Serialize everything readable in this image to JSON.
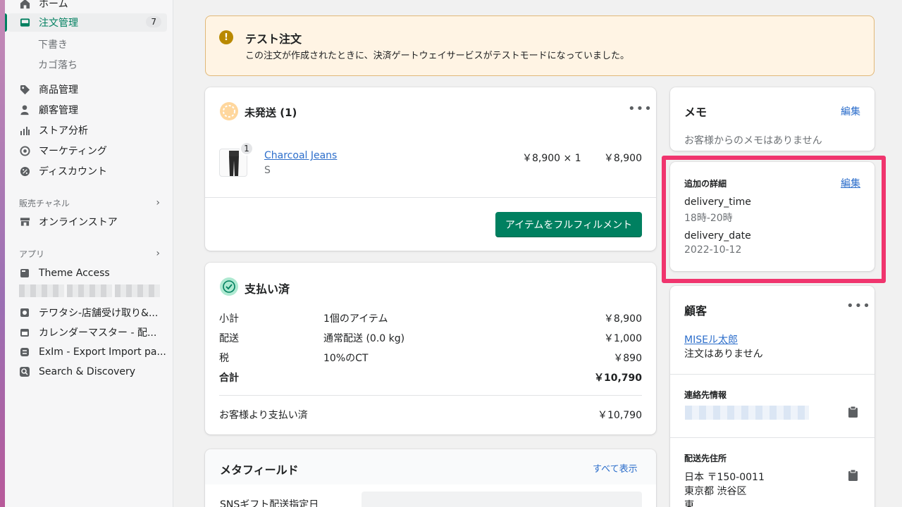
{
  "sidebar": {
    "home": "ホーム",
    "orders": "注文管理",
    "orders_badge": "7",
    "drafts": "下書き",
    "abandoned": "カゴ落ち",
    "products": "商品管理",
    "customers": "顧客管理",
    "analytics": "ストア分析",
    "marketing": "マーケティング",
    "discounts": "ディスカウント",
    "sales_channels_head": "販売チャネル",
    "online_store": "オンラインストア",
    "apps_head": "アプリ",
    "apps": [
      "Theme Access",
      "テワタシ-店舗受け取り&...",
      "カレンダーマスター - 配...",
      "ExIm - Export Import pa...",
      "Search & Discovery"
    ]
  },
  "banner": {
    "title": "テスト注文",
    "message": "この注文が作成されたときに、決済ゲートウェイサービスがテストモードになっていました。"
  },
  "unfulfilled": {
    "title": "未発送 (1)",
    "item_name": "Charcoal Jeans",
    "item_variant": "S",
    "item_qty_badge": "1",
    "item_price_qty": "￥8,900 × 1",
    "item_total": "￥8,900",
    "fulfill_button": "アイテムをフルフィルメント"
  },
  "payment": {
    "title": "支払い済",
    "rows": [
      {
        "label": "小計",
        "detail": "1個のアイテム",
        "amount": "￥8,900"
      },
      {
        "label": "配送",
        "detail": "通常配送 (0.0 kg)",
        "amount": "￥1,000"
      },
      {
        "label": "税",
        "detail": "10%のCT",
        "amount": "￥890"
      },
      {
        "label": "合計",
        "detail": "",
        "amount": "￥10,790"
      }
    ],
    "paid_label": "お客様より支払い済",
    "paid_amount": "￥10,790"
  },
  "metafields": {
    "title": "メタフィールド",
    "show_all": "すべて表示",
    "field_label": "SNSギフト配送指定日"
  },
  "memo": {
    "title": "メモ",
    "edit": "編集",
    "empty": "お客様からのメモはありません"
  },
  "additional": {
    "title": "追加の詳細",
    "edit": "編集",
    "k1": "delivery_time",
    "v1": "18時-20時",
    "k2": "delivery_date",
    "v2": "2022-10-12"
  },
  "customer": {
    "title": "顧客",
    "name": "MISEル太郎",
    "orders": "注文はありません",
    "contact_head": "連絡先情報",
    "shipping_head": "配送先住所",
    "addr1": "日本 〒150-0011",
    "addr2": "東京都 渋谷区",
    "addr3": "東"
  },
  "colors": {
    "accent": "#008060",
    "highlight": "#f0356e",
    "banner_bg": "#fff4e4"
  }
}
